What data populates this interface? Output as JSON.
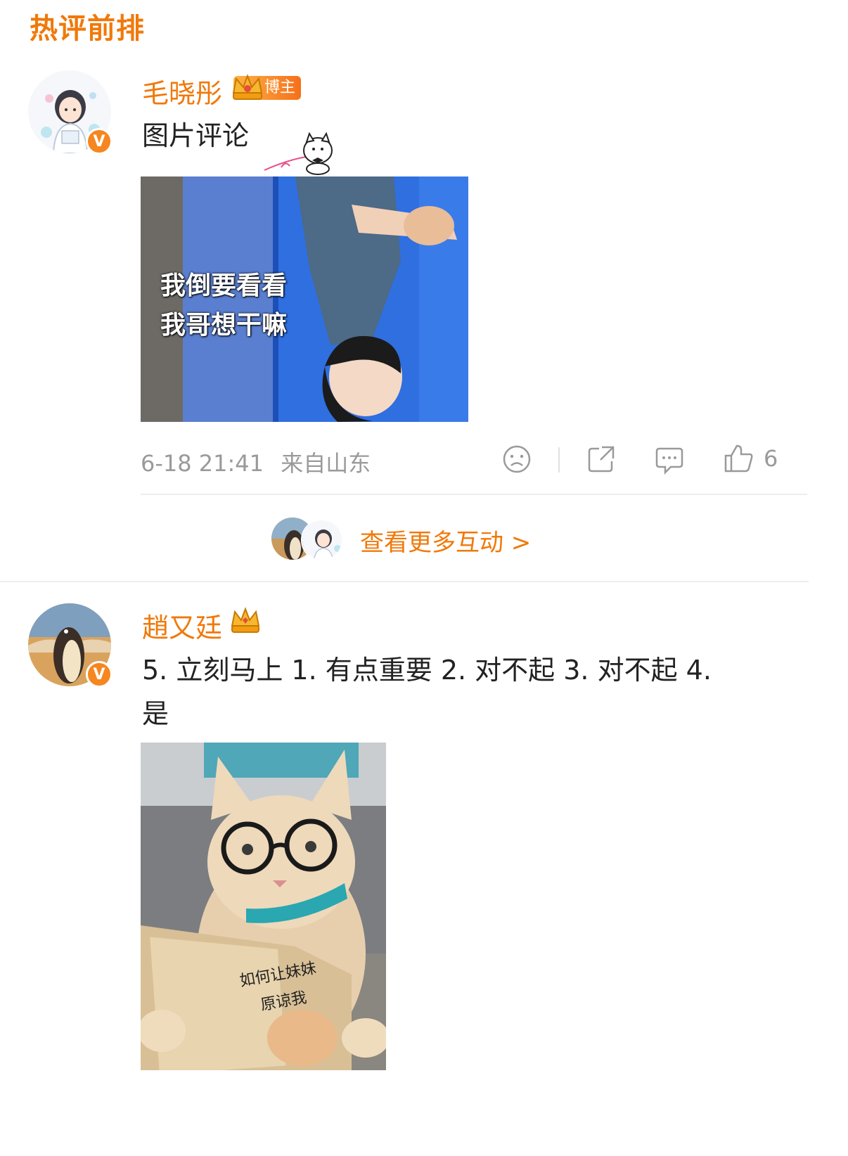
{
  "section": {
    "title": "热评前排"
  },
  "comments": [
    {
      "username": "毛晓彤",
      "badge_label": "博主",
      "verified_mark": "V",
      "text": "图片评论",
      "image_caption_line1": "我倒要看看",
      "image_caption_line2": "我哥想干嘛",
      "date": "6-18 21:41",
      "location": "来自山东",
      "like_count": "6"
    },
    {
      "username": "趙又廷",
      "verified_mark": "V",
      "text_line1": "5. 立刻马上  1. 有点重要 2. 对不起 3. 对不起 4.",
      "text_line2": "是",
      "image_caption_line1": "如何让妹妹",
      "image_caption_line2": "原谅我"
    }
  ],
  "more_interactions": {
    "label": "查看更多互动 >"
  },
  "icons": [
    "unhappy-face-icon",
    "share-icon",
    "comment-icon",
    "thumbs-up-icon",
    "crown-icon",
    "verified-v-icon"
  ],
  "colors": {
    "accent": "#f0790a",
    "meta_gray": "#9a9a9a",
    "divider": "#ededed"
  }
}
